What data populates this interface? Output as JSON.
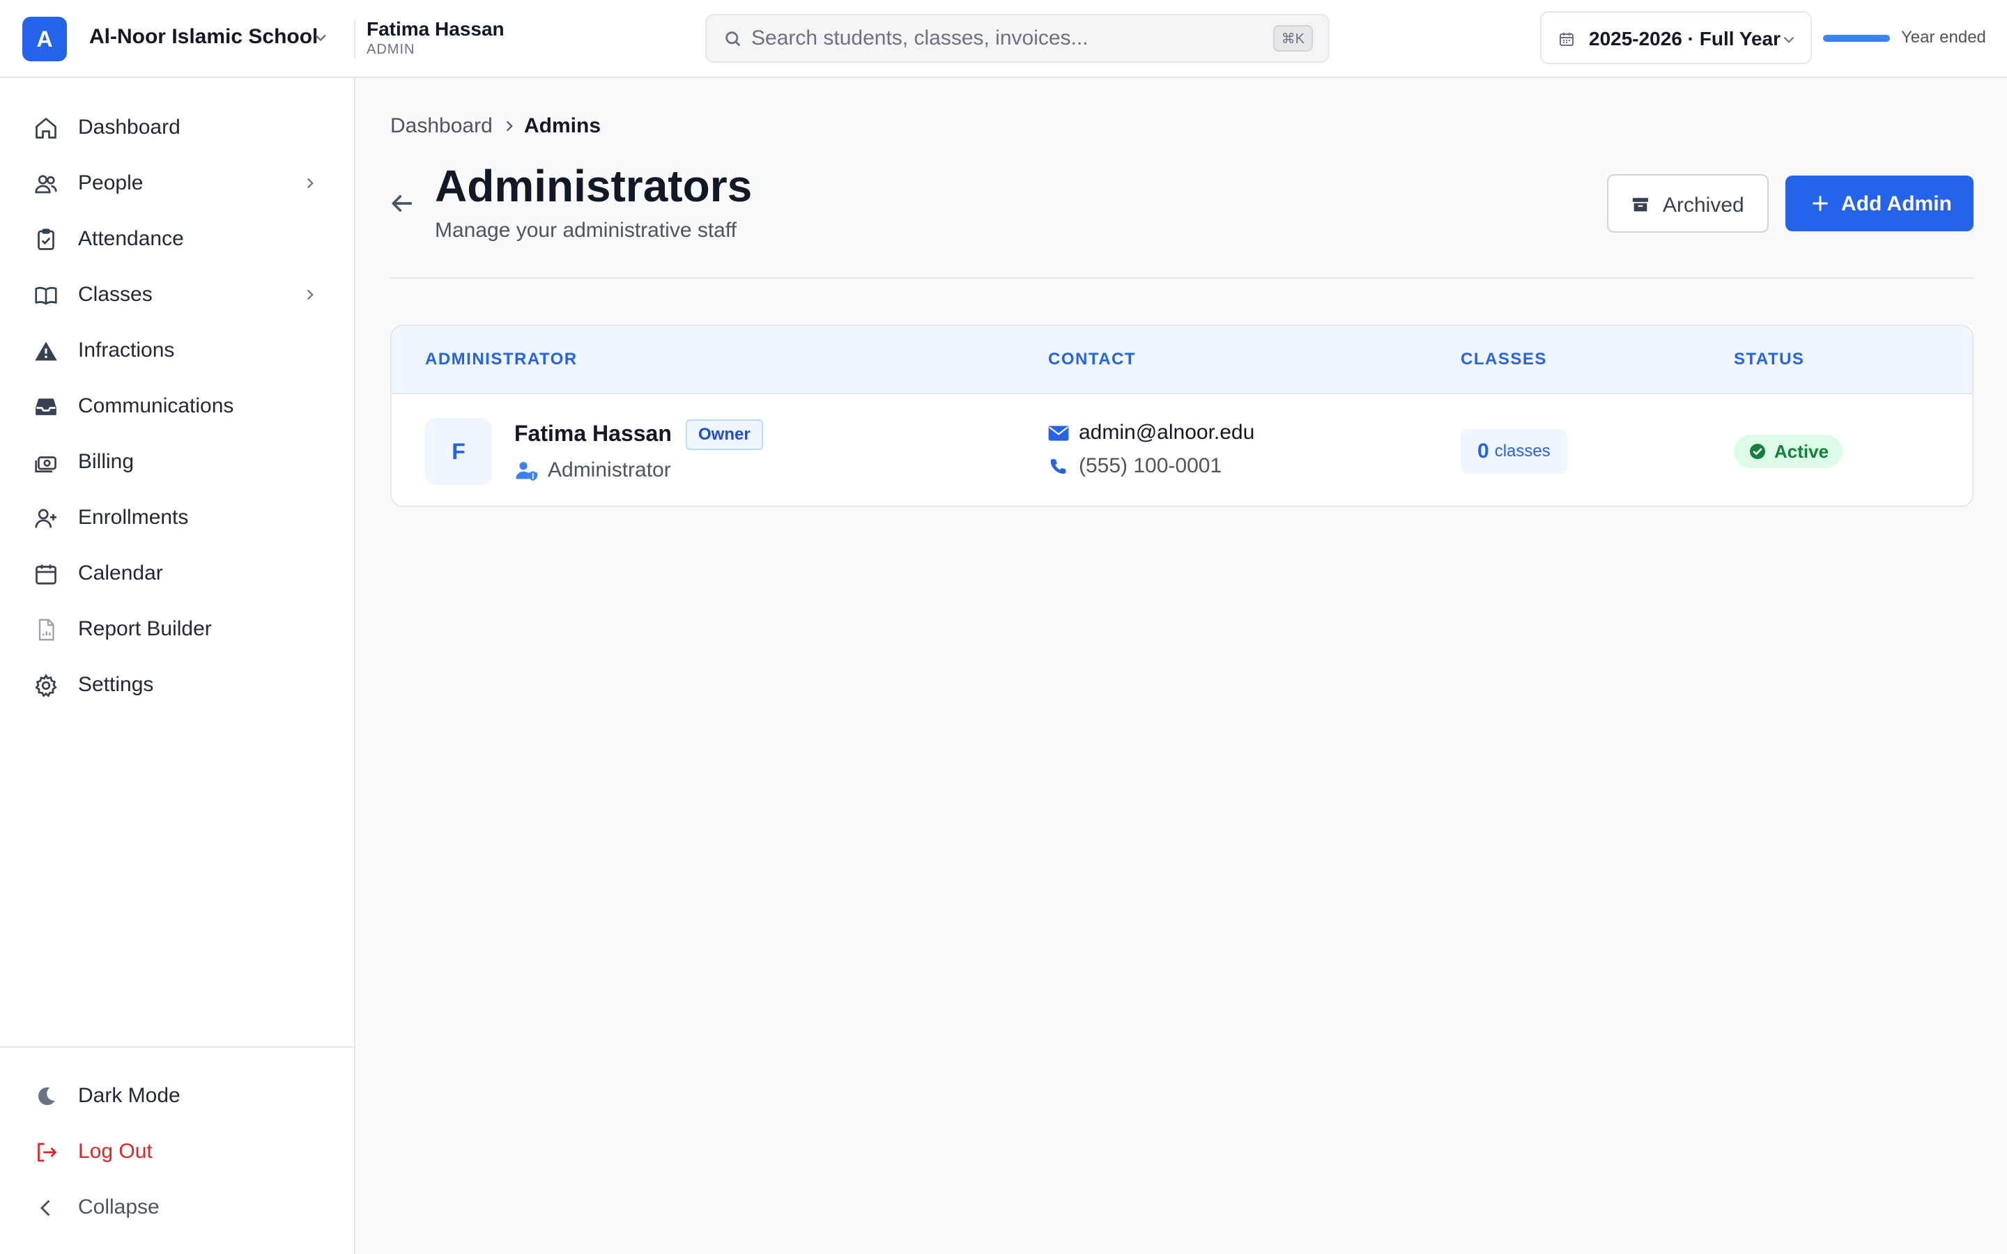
{
  "topbar": {
    "school_initial": "A",
    "school_name": "Al-Noor Islamic School",
    "user_name": "Fatima Hassan",
    "user_role": "ADMIN",
    "search_placeholder": "Search students, classes, invoices...",
    "search_shortcut": "⌘K",
    "year_label": "2025-2026 · Full Year",
    "year_progress": 1.0,
    "year_status": "Year ended"
  },
  "sidebar": {
    "items": [
      {
        "label": "Dashboard",
        "icon": "home-icon"
      },
      {
        "label": "People",
        "icon": "users-icon",
        "has_submenu": true
      },
      {
        "label": "Attendance",
        "icon": "clipboard-check-icon"
      },
      {
        "label": "Classes",
        "icon": "book-open-icon",
        "has_submenu": true
      },
      {
        "label": "Infractions",
        "icon": "warning-icon"
      },
      {
        "label": "Communications",
        "icon": "inbox-icon"
      },
      {
        "label": "Billing",
        "icon": "money-icon"
      },
      {
        "label": "Enrollments",
        "icon": "user-plus-icon"
      },
      {
        "label": "Calendar",
        "icon": "calendar-icon"
      },
      {
        "label": "Report Builder",
        "icon": "report-icon"
      },
      {
        "label": "Settings",
        "icon": "gear-icon"
      }
    ],
    "footer": {
      "dark_mode": "Dark Mode",
      "logout": "Log Out",
      "collapse": "Collapse"
    }
  },
  "breadcrumb": {
    "home": "Dashboard",
    "current": "Admins"
  },
  "page": {
    "title": "Administrators",
    "subtitle": "Manage your administrative staff",
    "archived_label": "Archived",
    "add_label": "Add Admin"
  },
  "table": {
    "columns": [
      "ADMINISTRATOR",
      "CONTACT",
      "CLASSES",
      "STATUS"
    ],
    "rows": [
      {
        "initial": "F",
        "name": "Fatima Hassan",
        "badge": "Owner",
        "role": "Administrator",
        "email": "admin@alnoor.edu",
        "phone": "(555) 100-0001",
        "classes_count": "0",
        "classes_word": "classes",
        "status": "Active"
      }
    ]
  },
  "colors": {
    "accent": "#2563eb",
    "active_green": "#15803d",
    "danger": "#dc2626"
  }
}
